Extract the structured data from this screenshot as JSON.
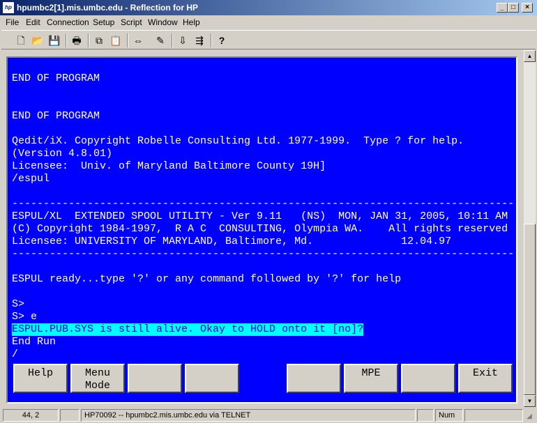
{
  "window": {
    "icon_label": "hp",
    "title": "hpumbc2[1].mis.umbc.edu - Reflection for HP",
    "min_glyph": "_",
    "max_glyph": "□",
    "close_glyph": "×"
  },
  "menu": [
    "File",
    "Edit",
    "Connection",
    "Setup",
    "Script",
    "Window",
    "Help"
  ],
  "toolbar_icons": [
    {
      "name": "new-icon",
      "glyph": "🗋"
    },
    {
      "name": "open-icon",
      "glyph": "📂"
    },
    {
      "name": "save-icon",
      "glyph": "💾"
    },
    {
      "name": "print-icon",
      "glyph": "🖶"
    },
    {
      "name": "copy-icon",
      "glyph": "⧉"
    },
    {
      "name": "paste-icon",
      "glyph": "📋"
    },
    {
      "name": "connect-icon",
      "glyph": "⇔"
    },
    {
      "name": "script-icon",
      "glyph": "✎"
    },
    {
      "name": "transfer-icon",
      "glyph": "⇩"
    },
    {
      "name": "send-icon",
      "glyph": "⇶"
    },
    {
      "name": "context-help-icon",
      "glyph": "?"
    }
  ],
  "terminal": {
    "lines": [
      {
        "row": 1,
        "text": "END OF PROGRAM"
      },
      {
        "row": 4,
        "text": "END OF PROGRAM"
      },
      {
        "row": 6,
        "text": "Qedit/iX. Copyright Robelle Consulting Ltd. 1977-1999.  Type ? for help."
      },
      {
        "row": 7,
        "text": "(Version 4.8.01)"
      },
      {
        "row": 8,
        "text": "Licensee:  Univ. of Maryland Baltimore County 19H]"
      },
      {
        "row": 9,
        "text": "/espul"
      },
      {
        "row": 11,
        "text": "--------------------------------------------------------------------------------"
      },
      {
        "row": 12,
        "text": "ESPUL/XL  EXTENDED SPOOL UTILITY - Ver 9.11   (NS)  MON, JAN 31, 2005, 10:11 AM"
      },
      {
        "row": 13,
        "text": "(C) Copyright 1984-1997,  R A C  CONSULTING, Olympia WA.    All rights reserved"
      },
      {
        "row": 14,
        "text": "Licensee: UNIVERSITY OF MARYLAND, Baltimore, Md.              12.04.97"
      },
      {
        "row": 15,
        "text": "--------------------------------------------------------------------------------"
      },
      {
        "row": 17,
        "text": "ESPUL ready...type '?' or any command followed by '?' for help"
      },
      {
        "row": 19,
        "text": "S>"
      },
      {
        "row": 20,
        "text": "S> e"
      },
      {
        "row": 21,
        "text": "ESPUL.PUB.SYS is still alive. Okay to HOLD onto it [no]?",
        "highlight": true
      },
      {
        "row": 22,
        "text": "End Run"
      },
      {
        "row": 23,
        "text": "/"
      }
    ]
  },
  "function_keys": [
    {
      "label": "Help"
    },
    {
      "label": "Menu\nMode"
    },
    {
      "label": ""
    },
    {
      "label": ""
    },
    {
      "label": ""
    },
    {
      "label": "MPE"
    },
    {
      "label": ""
    },
    {
      "label": "Exit"
    }
  ],
  "scrollbar": {
    "up_glyph": "▲",
    "down_glyph": "▼"
  },
  "status": {
    "cursor": "44, 2",
    "connection": "HP70092 -- hpumbc2.mis.umbc.edu via TELNET",
    "num": "Num"
  }
}
